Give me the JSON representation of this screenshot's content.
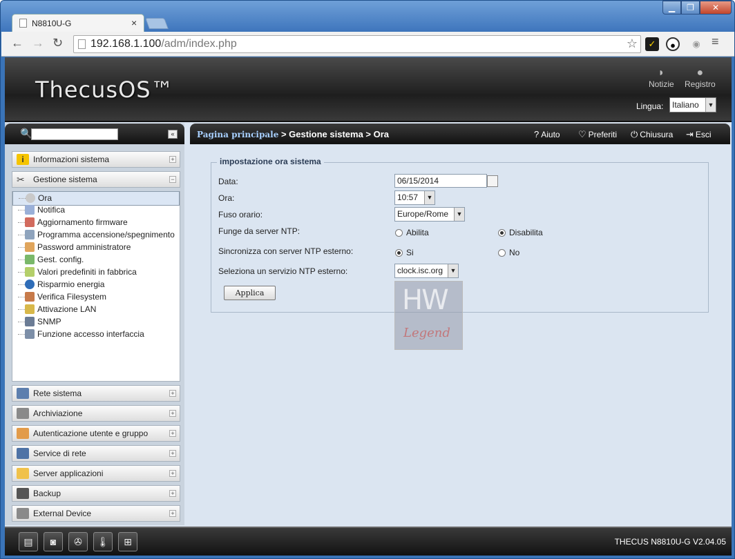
{
  "browser": {
    "tab_title": "N8810U-G",
    "tab_close": "×",
    "url_host": "192.168.1.100",
    "url_path": "/adm/index.php",
    "window_buttons": {
      "minimize": "▁",
      "maximize": "❐",
      "close": "✕"
    },
    "nav": {
      "back": "←",
      "forward": "→",
      "reload": "↻",
      "star": "☆",
      "menu": "≡"
    }
  },
  "header": {
    "logo": "ThecusOS™",
    "news": {
      "icon": "rss-icon",
      "label": "Notizie"
    },
    "log": {
      "icon": "speech-icon",
      "label": "Registro"
    },
    "language_label": "Lingua:",
    "language_value": "Italiano"
  },
  "sidebar": {
    "search_placeholder": "",
    "collapse_glyph": "«",
    "sections": [
      {
        "label": "Informazioni sistema",
        "icon": "info-icon",
        "state": "+"
      },
      {
        "label": "Gestione sistema",
        "icon": "tools-icon",
        "state": "−"
      },
      {
        "label": "Rete sistema",
        "icon": "network-icon",
        "state": "+"
      },
      {
        "label": "Archiviazione",
        "icon": "storage-icon",
        "state": "+"
      },
      {
        "label": "Autenticazione utente e gruppo",
        "icon": "users-icon",
        "state": "+"
      },
      {
        "label": "Service di rete",
        "icon": "network-service-icon",
        "state": "+"
      },
      {
        "label": "Server applicazioni",
        "icon": "folder-app-icon",
        "state": "+"
      },
      {
        "label": "Backup",
        "icon": "backup-icon",
        "state": "+"
      },
      {
        "label": "External Device",
        "icon": "external-device-icon",
        "state": "+"
      }
    ],
    "tree_items": [
      {
        "label": "Ora",
        "icon": "clock-icon"
      },
      {
        "label": "Notifica",
        "icon": "notification-icon"
      },
      {
        "label": "Aggiornamento firmware",
        "icon": "firmware-icon"
      },
      {
        "label": "Programma accensione/spegnimento",
        "icon": "schedule-power-icon"
      },
      {
        "label": "Password amministratore",
        "icon": "admin-user-icon"
      },
      {
        "label": "Gest. config.",
        "icon": "config-icon"
      },
      {
        "label": "Valori predefiniti in fabbrica",
        "icon": "factory-reset-icon"
      },
      {
        "label": "Risparmio energia",
        "icon": "power-save-icon"
      },
      {
        "label": "Verifica Filesystem",
        "icon": "filesystem-check-icon"
      },
      {
        "label": "Attivazione LAN",
        "icon": "wake-on-lan-icon"
      },
      {
        "label": "SNMP",
        "icon": "snmp-icon"
      },
      {
        "label": "Funzione accesso interfaccia",
        "icon": "ui-access-icon"
      }
    ]
  },
  "content": {
    "breadcrumb_home": "Pagina principale",
    "breadcrumb_rest": " > Gestione sistema > Ora",
    "tools": {
      "help": "Aiuto",
      "favorites": "Preferiti",
      "shutdown": "Chiusura",
      "logout": "Esci"
    },
    "panel_title": "impostazione ora sistema",
    "form": {
      "date_label": "Data:",
      "date_value": "06/15/2014",
      "time_label": "Ora:",
      "time_value": "10:57",
      "tz_label": "Fuso orario:",
      "tz_value": "Europe/Rome",
      "ntp_server_label": "Funge da server NTP:",
      "ntp_server_on": "Abilita",
      "ntp_server_off": "Disabilita",
      "ntp_server_selected": "Disabilita",
      "sync_label": "Sincronizza con server NTP esterno:",
      "sync_yes": "Si",
      "sync_no": "No",
      "sync_selected": "Si",
      "ntp_select_label": "Seleziona un servizio NTP esterno:",
      "ntp_select_value": "clock.isc.org",
      "apply": "Applica"
    },
    "watermark_top": "HW",
    "watermark_bottom": "Legend"
  },
  "footer": {
    "version": "THECUS N8810U-G V2.04.05",
    "buttons": [
      "server-icon",
      "disk-icon",
      "fan-icon",
      "thermometer-icon",
      "network-tree-icon"
    ]
  }
}
